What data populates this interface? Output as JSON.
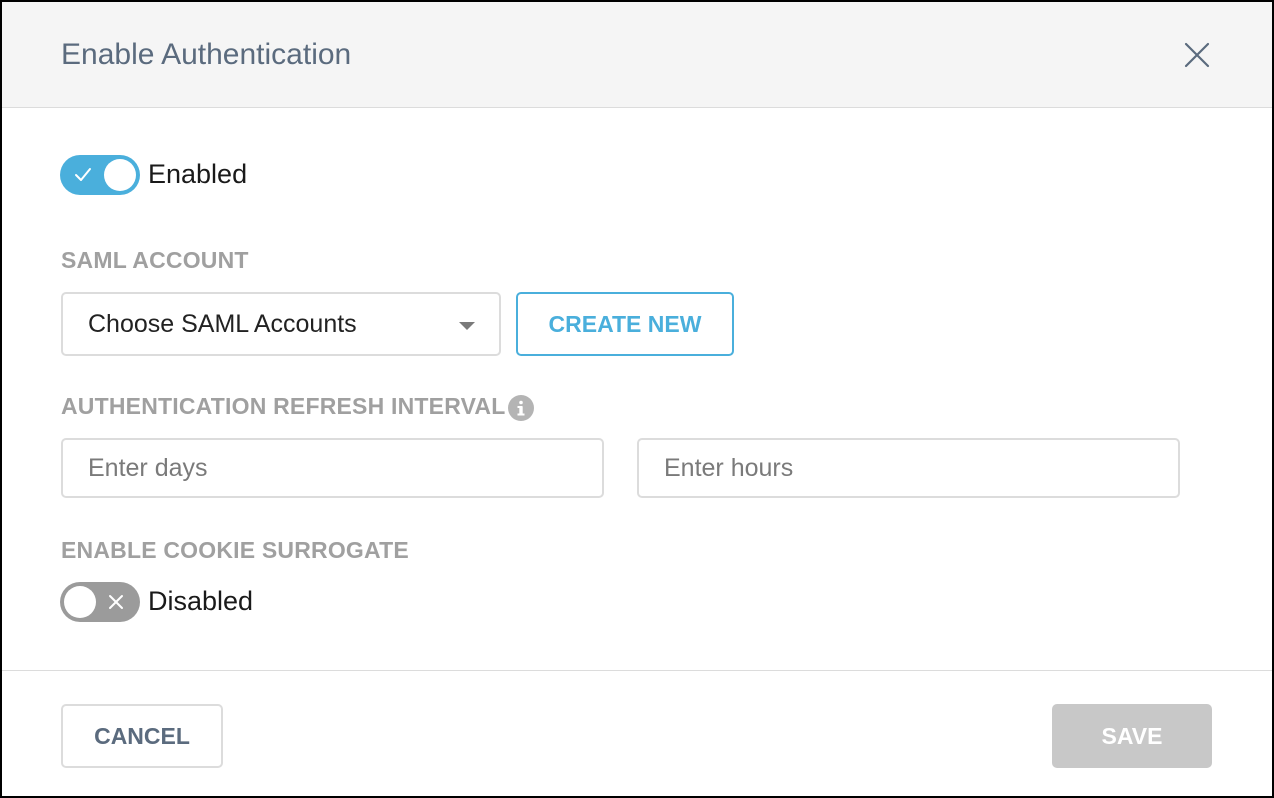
{
  "dialog": {
    "title": "Enable Authentication",
    "close_icon": "close-icon"
  },
  "authentication_toggle": {
    "state": "on",
    "label": "Enabled",
    "accent_color": "#4aafdc"
  },
  "saml_account": {
    "section_label": "SAML ACCOUNT",
    "select_value": "Choose SAML Accounts",
    "create_button_label": "CREATE NEW"
  },
  "refresh_interval": {
    "section_label": "AUTHENTICATION REFRESH INTERVAL",
    "info_icon": "info-icon",
    "days_placeholder": "Enter days",
    "hours_placeholder": "Enter hours"
  },
  "cookie_surrogate": {
    "section_label": "ENABLE COOKIE SURROGATE",
    "state": "off",
    "label": "Disabled"
  },
  "footer": {
    "cancel_label": "CANCEL",
    "save_label": "SAVE",
    "save_disabled": true
  }
}
